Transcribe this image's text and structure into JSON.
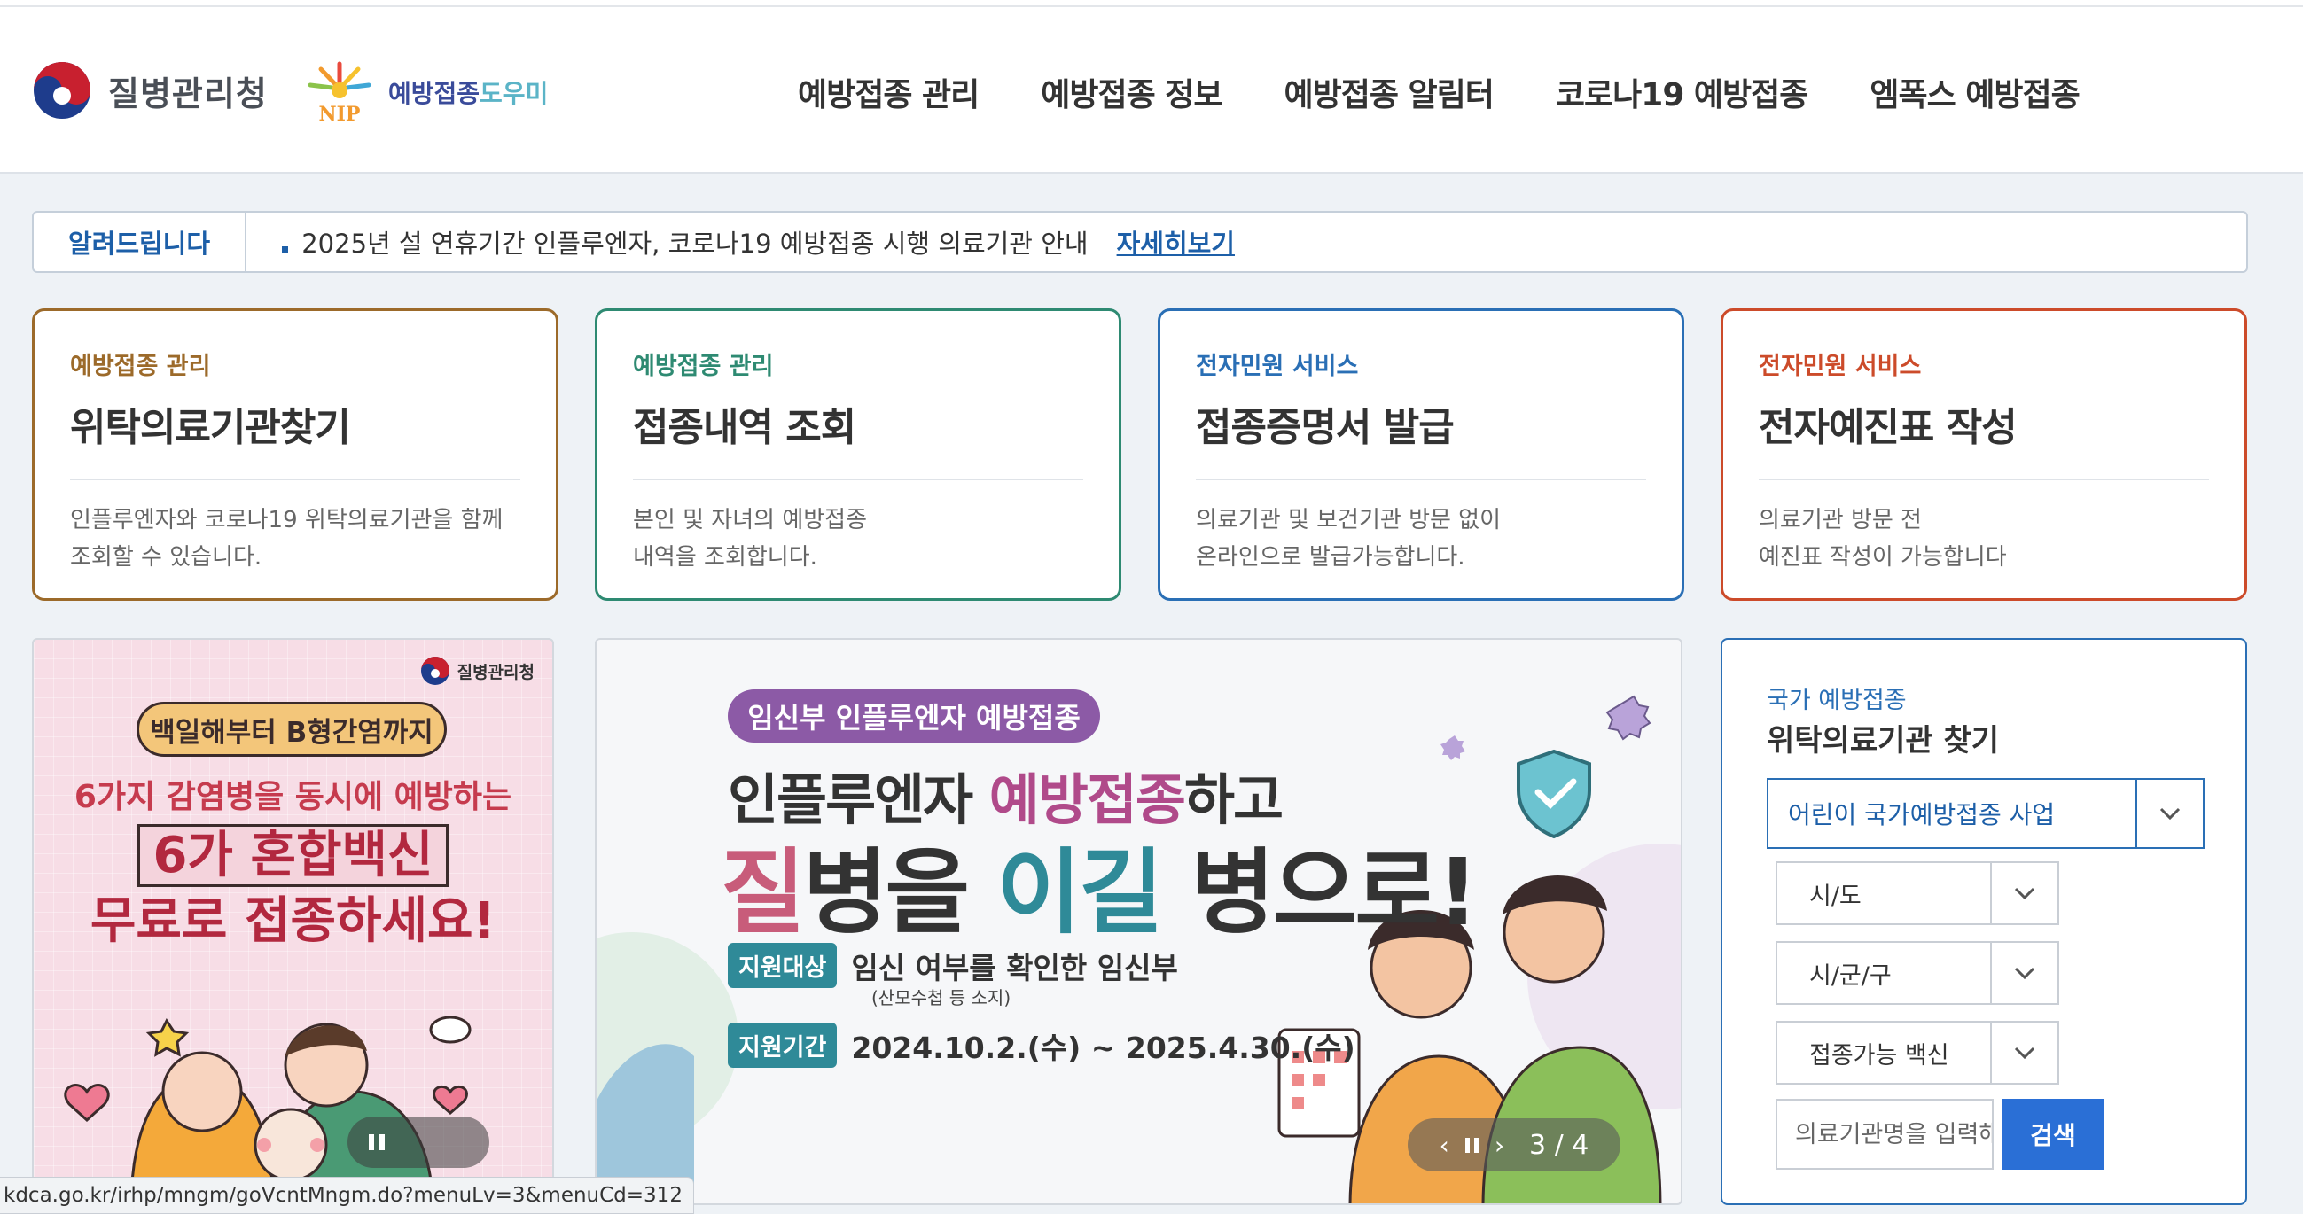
{
  "header": {
    "org_name": "질병관리청",
    "nip_name_a": "예방접종",
    "nip_name_b": "도우미",
    "nip_badge": "NIP",
    "nav": [
      "예방접종 관리",
      "예방접종 정보",
      "예방접종 알림터",
      "코로나19 예방접종",
      "엠폭스 예방접종"
    ]
  },
  "notice": {
    "tag": "알려드립니다",
    "message": "2025년 설 연휴기간 인플루엔자, 코로나19 예방접종 시행 의료기관 안내",
    "more": "자세히보기"
  },
  "cards": [
    {
      "category": "예방접종 관리",
      "title": "위탁의료기관찾기",
      "desc": "인플루엔자와 코로나19 위탁의료기관을 함께\n조회할 수 있습니다."
    },
    {
      "category": "예방접종 관리",
      "title": "접종내역 조회",
      "desc": "본인 및 자녀의 예방접종\n내역을 조회합니다."
    },
    {
      "category": "전자민원 서비스",
      "title": "접종증명서 발급",
      "desc": "의료기관 및 보건기관 방문 없이\n온라인으로 발급가능합니다."
    },
    {
      "category": "전자민원 서비스",
      "title": "전자예진표 작성",
      "desc": "의료기관 방문 전\n예진표 작성이 가능합니다"
    }
  ],
  "banner_left": {
    "org": "질병관리청",
    "pill": "백일해부터 B형간염까지",
    "line1": "6가지 감염병을 동시에 예방하는",
    "line2": "6가 혼합백신",
    "line3": "무료로 접종하세요!"
  },
  "banner_center": {
    "pill": "임신부 인플루엔자 예방접종",
    "h1_a": "인플루엔자 ",
    "h1_b": "예방접종",
    "h1_c": "하고",
    "h2_a": "질",
    "h2_b": "병을 ",
    "h2_c": "이길",
    "h2_d": " 병으로!",
    "target_tag": "지원대상",
    "target_val": "임신 여부를 확인한 임신부",
    "target_sub": "(산모수첩 등 소지)",
    "period_tag": "지원기간",
    "period_val": "2024.10.2.(수) ~ 2025.4.30.(수)",
    "pager": "3 / 4"
  },
  "finder": {
    "subtitle": "국가 예방접종",
    "title": "위탁의료기관 찾기",
    "program": "어린이 국가예방접종 사업",
    "region": "시/도",
    "district": "시/군/구",
    "vaccine": "접종가능 백신",
    "search_placeholder": "의료기관명을 입력해주세요",
    "search_button": "검색"
  },
  "statusbar": {
    "url": "kdca.go.kr/irhp/mngm/goVcntMngm.do?menuLv=3&menuCd=312"
  },
  "colors": {
    "primary": "#2a6fb5",
    "card1": "#9c6a2a",
    "card2": "#2e8a72",
    "card3": "#2a6fb5",
    "card4": "#cc4b2a"
  }
}
